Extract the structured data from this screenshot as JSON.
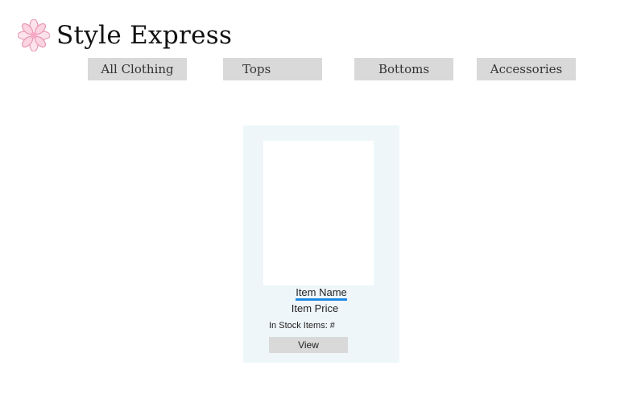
{
  "header": {
    "brand_name": "Style Express",
    "logo_icon": "flower-icon",
    "logo_color": "#f4b6cc"
  },
  "nav": {
    "items": [
      {
        "label": "All Clothing"
      },
      {
        "label": "Tops"
      },
      {
        "label": "Bottoms"
      },
      {
        "label": "Accessories"
      }
    ]
  },
  "product_card": {
    "name": "Item Name",
    "price": "Item Price",
    "stock_text": "In Stock Items: #",
    "view_label": "View",
    "link_accent": "#1e88e5"
  }
}
